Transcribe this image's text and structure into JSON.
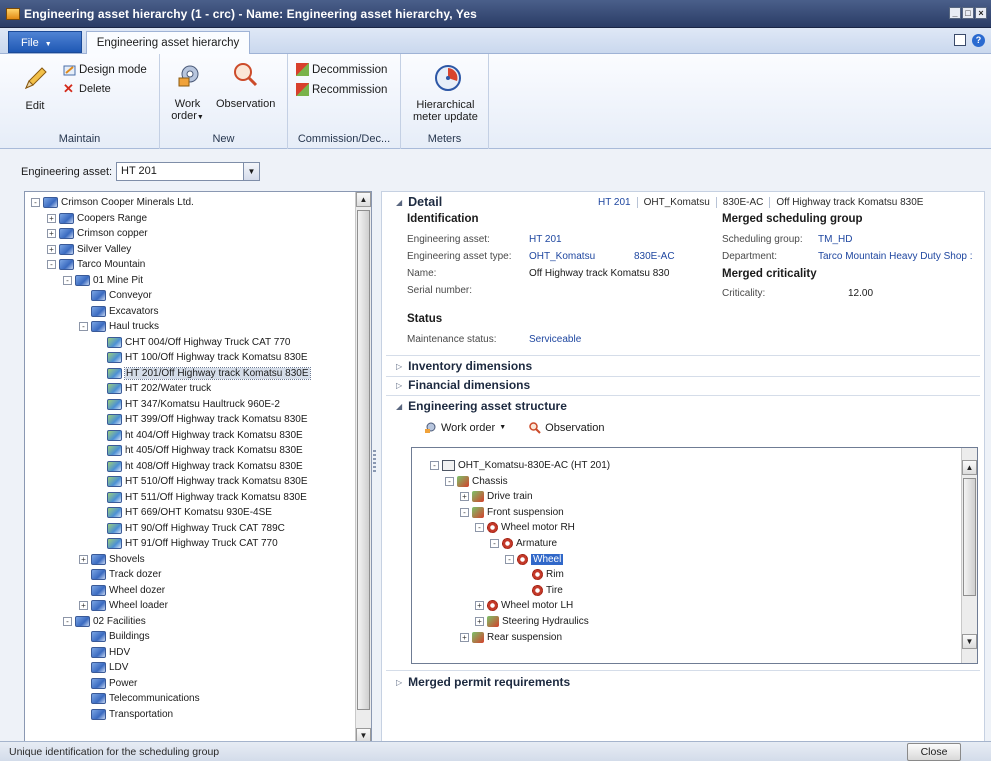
{
  "window": {
    "title": "Engineering asset hierarchy (1 - crc) - Name: Engineering asset hierarchy, Yes",
    "controls": [
      "_",
      "□",
      "×"
    ]
  },
  "tabs": {
    "file": "File",
    "active": "Engineering asset hierarchy"
  },
  "ribbon": {
    "maintain": {
      "label": "Maintain",
      "edit": "Edit",
      "design_mode": "Design mode",
      "delete": "Delete"
    },
    "new": {
      "label": "New",
      "work_order_1": "Work",
      "work_order_2": "order",
      "observation": "Observation"
    },
    "commission": {
      "label": "Commission/Dec...",
      "decommission": "Decommission",
      "recommission": "Recommission"
    },
    "meters": {
      "label": "Meters",
      "hmu_1": "Hierarchical",
      "hmu_2": "meter update"
    }
  },
  "filter": {
    "label": "Engineering asset:",
    "value": "HT 201"
  },
  "tree": {
    "nodes": [
      {
        "label": "Crimson Cooper Minerals Ltd.",
        "level": 0,
        "exp": "-"
      },
      {
        "label": "Coopers Range",
        "level": 1,
        "exp": "+"
      },
      {
        "label": "Crimson copper",
        "level": 1,
        "exp": "+"
      },
      {
        "label": "Silver Valley",
        "level": 1,
        "exp": "+"
      },
      {
        "label": "Tarco Mountain",
        "level": 1,
        "exp": "-"
      },
      {
        "label": "01 Mine Pit",
        "level": 2,
        "exp": "-"
      },
      {
        "label": "Conveyor",
        "level": 3,
        "exp": ""
      },
      {
        "label": "Excavators",
        "level": 3,
        "exp": ""
      },
      {
        "label": "Haul trucks",
        "level": 3,
        "exp": "-"
      },
      {
        "label": "CHT 004/Off Highway Truck CAT 770",
        "level": 4,
        "exp": "",
        "asset": true
      },
      {
        "label": "HT 100/Off Highway track Komatsu 830E",
        "level": 4,
        "exp": "",
        "asset": true
      },
      {
        "label": "HT 201/Off Highway track Komatsu 830E",
        "level": 4,
        "exp": "",
        "asset": true,
        "selected": true
      },
      {
        "label": "HT 202/Water truck",
        "level": 4,
        "exp": "",
        "asset": true
      },
      {
        "label": "HT 347/Komatsu Haultruck 960E-2",
        "level": 4,
        "exp": "",
        "asset": true
      },
      {
        "label": "HT 399/Off Highway track Komatsu 830E",
        "level": 4,
        "exp": "",
        "asset": true
      },
      {
        "label": "ht 404/Off Highway track Komatsu 830E",
        "level": 4,
        "exp": "",
        "asset": true
      },
      {
        "label": "ht 405/Off Highway track Komatsu 830E",
        "level": 4,
        "exp": "",
        "asset": true
      },
      {
        "label": "ht 408/Off Highway track Komatsu 830E",
        "level": 4,
        "exp": "",
        "asset": true
      },
      {
        "label": "HT 510/Off Highway track Komatsu 830E",
        "level": 4,
        "exp": "",
        "asset": true
      },
      {
        "label": "HT 511/Off Highway track Komatsu 830E",
        "level": 4,
        "exp": "",
        "asset": true
      },
      {
        "label": "HT 669/OHT Komatsu 930E-4SE",
        "level": 4,
        "exp": "",
        "asset": true
      },
      {
        "label": "HT 90/Off Highway Truck CAT 789C",
        "level": 4,
        "exp": "",
        "asset": true
      },
      {
        "label": "HT 91/Off Highway Truck CAT 770",
        "level": 4,
        "exp": "",
        "asset": true
      },
      {
        "label": "Shovels",
        "level": 3,
        "exp": "+"
      },
      {
        "label": "Track dozer",
        "level": 3,
        "exp": ""
      },
      {
        "label": "Wheel dozer",
        "level": 3,
        "exp": ""
      },
      {
        "label": "Wheel loader",
        "level": 3,
        "exp": "+"
      },
      {
        "label": "02 Facilities",
        "level": 2,
        "exp": "-"
      },
      {
        "label": "Buildings",
        "level": 3,
        "exp": ""
      },
      {
        "label": "HDV",
        "level": 3,
        "exp": ""
      },
      {
        "label": "LDV",
        "level": 3,
        "exp": ""
      },
      {
        "label": "Power",
        "level": 3,
        "exp": ""
      },
      {
        "label": "Telecommunications",
        "level": 3,
        "exp": ""
      },
      {
        "label": "Transportation",
        "level": 3,
        "exp": ""
      }
    ]
  },
  "detail": {
    "heading": "Detail",
    "summary": [
      "HT 201",
      "OHT_Komatsu",
      "830E-AC",
      "Off Highway track Komatsu 830E"
    ],
    "identification": {
      "heading": "Identification",
      "asset_label": "Engineering asset:",
      "asset_value": "HT 201",
      "type_label": "Engineering asset type:",
      "type_value": "OHT_Komatsu",
      "type_value2": "830E-AC",
      "name_label": "Name:",
      "name_value": "Off Highway track Komatsu 830",
      "serial_label": "Serial number:"
    },
    "scheduling": {
      "heading": "Merged scheduling group",
      "group_label": "Scheduling group:",
      "group_value": "TM_HD",
      "dept_label": "Department:",
      "dept_value": "Tarco Mountain Heavy Duty Shop :"
    },
    "criticality": {
      "heading": "Merged criticality",
      "label": "Criticality:",
      "value": "12.00"
    },
    "status": {
      "heading": "Status",
      "label": "Maintenance status:",
      "value": "Serviceable"
    }
  },
  "fasttabs": {
    "inventory": "Inventory dimensions",
    "financial": "Financial dimensions",
    "structure": "Engineering asset structure",
    "permits": "Merged permit requirements"
  },
  "structure": {
    "work_order": "Work order",
    "observation": "Observation",
    "nodes": [
      {
        "label": "OHT_Komatsu-830E-AC (HT 201)",
        "indent": 0,
        "exp": "-",
        "icon": "box"
      },
      {
        "label": "Chassis",
        "indent": 1,
        "exp": "-",
        "icon": "green"
      },
      {
        "label": "Drive train",
        "indent": 2,
        "exp": "+",
        "icon": "green"
      },
      {
        "label": "Front suspension",
        "indent": 2,
        "exp": "-",
        "icon": "green"
      },
      {
        "label": "Wheel motor RH",
        "indent": 3,
        "exp": "-",
        "icon": "red"
      },
      {
        "label": "Armature",
        "indent": 4,
        "exp": "-",
        "icon": "red"
      },
      {
        "label": "Wheel",
        "indent": 5,
        "exp": "-",
        "icon": "red",
        "selected": true
      },
      {
        "label": "Rim",
        "indent": 6,
        "exp": "",
        "icon": "red"
      },
      {
        "label": "Tire",
        "indent": 6,
        "exp": "",
        "icon": "red"
      },
      {
        "label": "Wheel motor LH",
        "indent": 3,
        "exp": "+",
        "icon": "red"
      },
      {
        "label": "Steering Hydraulics",
        "indent": 3,
        "exp": "+",
        "icon": "green"
      },
      {
        "label": "Rear suspension",
        "indent": 2,
        "exp": "+",
        "icon": "green"
      }
    ]
  },
  "statusbar": {
    "text": "Unique identification for the scheduling group",
    "close": "Close"
  }
}
